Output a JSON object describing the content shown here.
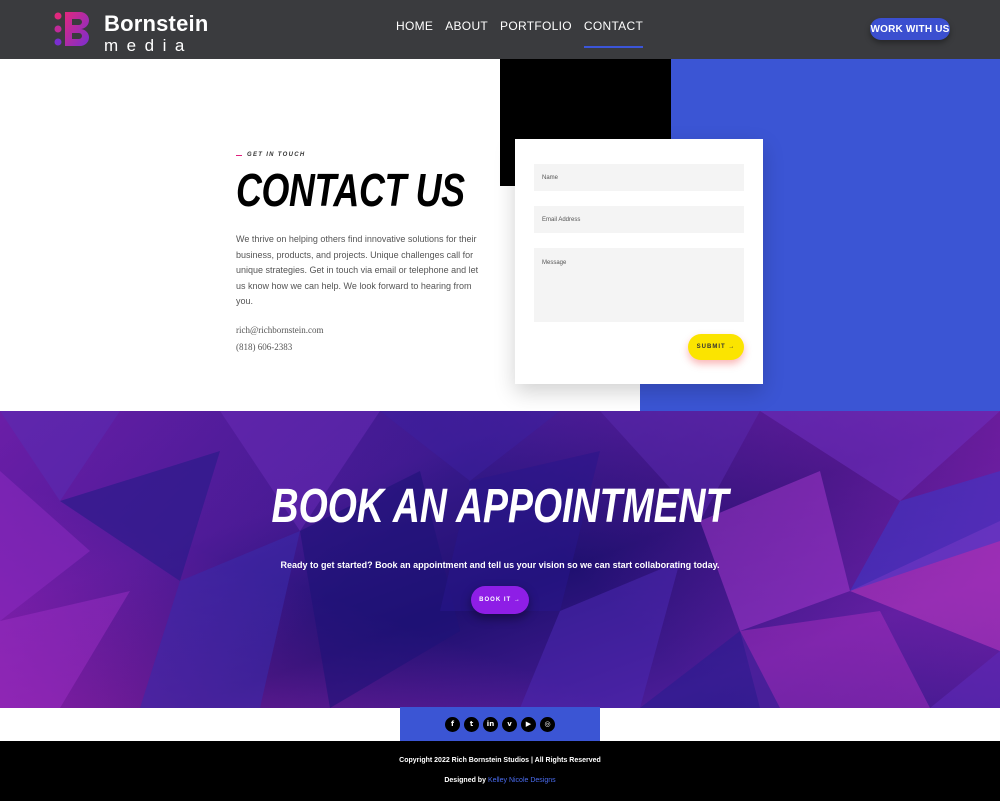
{
  "header": {
    "logo_name": "Bornstein",
    "logo_sub": "media",
    "nav": [
      {
        "label": "HOME"
      },
      {
        "label": "ABOUT"
      },
      {
        "label": "PORTFOLIO"
      },
      {
        "label": "CONTACT"
      }
    ],
    "active_nav": "CONTACT",
    "cta_label": "WORK WITH US"
  },
  "contact": {
    "eyebrow": "GET IN TOUCH",
    "title": "CONTACT US",
    "description": "We thrive on helping others find innovative solutions for their business, products, and projects. Unique challenges call for unique strategies. Get in touch via email or telephone and let us know how we can help. We look forward to hearing from you.",
    "email": "rich@richbornstein.com",
    "phone": "(818) 606-2383",
    "form": {
      "name_placeholder": "Name",
      "email_placeholder": "Email Address",
      "message_placeholder": "Message",
      "submit_label": "SUBMIT →"
    }
  },
  "appointment": {
    "title": "BOOK AN APPOINTMENT",
    "subtitle": "Ready to get started? Book an appointment and tell us your vision so we can start collaborating today.",
    "button_label": "BOOK IT →"
  },
  "social": [
    {
      "icon": "facebook-icon",
      "glyph": "f"
    },
    {
      "icon": "twitter-icon",
      "glyph": "t"
    },
    {
      "icon": "linkedin-icon",
      "glyph": "in"
    },
    {
      "icon": "vimeo-icon",
      "glyph": "v"
    },
    {
      "icon": "youtube-icon",
      "glyph": "▶"
    },
    {
      "icon": "instagram-icon",
      "glyph": "◎"
    }
  ],
  "footer": {
    "copyright": "Copyright 2022 Rich Bornstein Studios | All Rights Reserved",
    "designed_prefix": "Designed by",
    "designer": "Kelley Nicole Designs"
  },
  "colors": {
    "accent_blue": "#3b55d4",
    "header_bg": "#3a3b3e",
    "submit_yellow": "#fbe400",
    "book_purple": "#8e1ee6"
  }
}
